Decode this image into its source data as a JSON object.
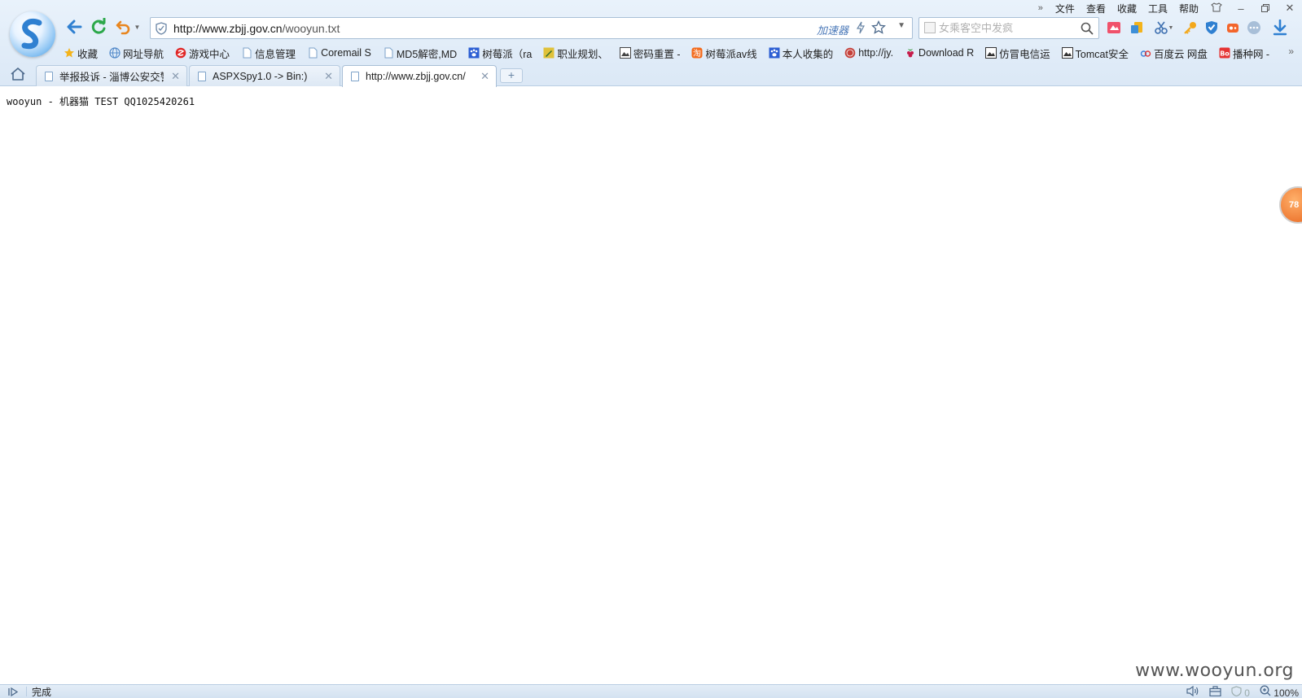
{
  "window": {
    "menu": [
      "文件",
      "查看",
      "收藏",
      "工具",
      "帮助"
    ]
  },
  "address": {
    "domain": "http://www.zbjj.gov.cn",
    "path": "/wooyun.txt",
    "accelerator": "加速器"
  },
  "search": {
    "placeholder": "女乘客空中发疯"
  },
  "bookmarks": [
    {
      "label": "收藏",
      "icon": "star-icon",
      "color": "#f3b31b"
    },
    {
      "label": "网址导航",
      "icon": "globe-icon",
      "color": "#4f87c8"
    },
    {
      "label": "游戏中心",
      "icon": "game-icon",
      "color": "#e02727"
    },
    {
      "label": "信息管理",
      "icon": "page-icon",
      "color": "#7da2c9"
    },
    {
      "label": "Coremail S",
      "icon": "page-icon",
      "color": "#7da2c9"
    },
    {
      "label": "MD5解密,MD",
      "icon": "page-icon",
      "color": "#7da2c9"
    },
    {
      "label": "树莓派（ra",
      "icon": "paw-icon",
      "color": "#2d5fd3"
    },
    {
      "label": "职业规划、",
      "icon": "pencil-icon",
      "color": "#e0c23a"
    },
    {
      "label": "密码重置 -",
      "icon": "image-icon",
      "color": "#444444"
    },
    {
      "label": "树莓派av线",
      "icon": "taobao-icon",
      "color": "#f36a1b"
    },
    {
      "label": "本人收集的",
      "icon": "paw-icon",
      "color": "#2d5fd3"
    },
    {
      "label": "http://jy.",
      "icon": "seal-icon",
      "color": "#c4413b"
    },
    {
      "label": "Download R",
      "icon": "raspberry-icon",
      "color": "#c51a4a"
    },
    {
      "label": "仿冒电信运",
      "icon": "image-icon",
      "color": "#333333"
    },
    {
      "label": "Tomcat安全",
      "icon": "image-icon",
      "color": "#333333"
    },
    {
      "label": "百度云 网盘",
      "icon": "cloud-icon",
      "color": "#3b7fd9"
    },
    {
      "label": "播种网 -",
      "icon": "bo-icon",
      "color": "#e53333"
    }
  ],
  "tabs": [
    {
      "label": "举报投诉 - 淄博公安交警"
    },
    {
      "label": "ASPXSpy1.0 -> Bin:)"
    },
    {
      "label": "http://www.zbjj.gov.cn/"
    }
  ],
  "content": {
    "text": "wooyun - 机器猫 TEST QQ1025420261"
  },
  "side_badge": "78",
  "watermark": "www.wooyun.org",
  "status": {
    "text": "完成",
    "adblock_count": "0",
    "zoom": "100%"
  },
  "colors": {
    "chrome_bg": "#dbe8f6",
    "accent": "#2f80d1",
    "refresh": "#2ca84a",
    "undo": "#e8861f"
  }
}
